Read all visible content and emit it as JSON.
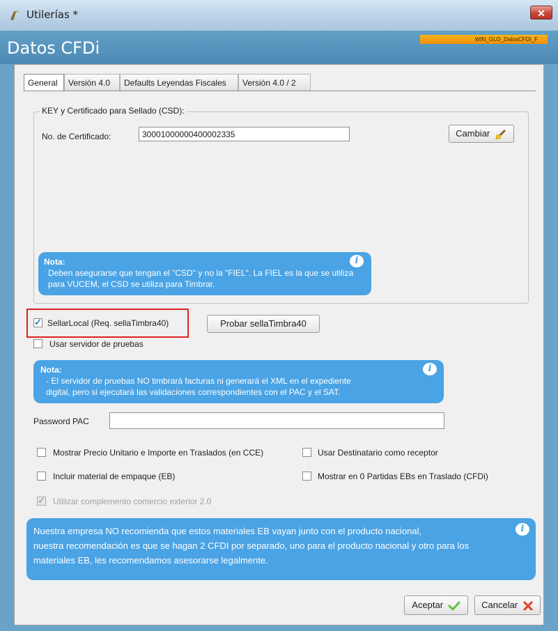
{
  "window": {
    "title": "Utilerías *",
    "close_label": "✕",
    "form_name": "WIN_GLO_DatosCFDI_F",
    "dialog_title": "Datos CFDi"
  },
  "tabs": [
    {
      "label": "General",
      "active": true
    },
    {
      "label": "Versión 4.0",
      "active": false
    },
    {
      "label": "Defaults Leyendas Fiscales",
      "active": false
    },
    {
      "label": "Versión 4.0 / 2",
      "active": false
    }
  ],
  "csd": {
    "legend": "KEY y Certificado para Sellado (CSD):",
    "cert_label": "No. de Certificado:",
    "cert_value": "30001000000400002335",
    "change_button": "Cambiar",
    "note_title": "Nota:",
    "note_text": "Deben asegurarse que tengan el \"CSD\" y no la \"FIEL\". La FIEL es la que se utiliza para VUCEM, el CSD se utiliza para Timbrar."
  },
  "sellar": {
    "checkbox_label": "SellarLocal (Req. sellaTimbra40)",
    "checked": true,
    "test_button": "Probar sellaTimbra40"
  },
  "test_server": {
    "checkbox_label": "Usar servidor de pruebas",
    "checked": false,
    "note_title": "Nota:",
    "note_line1": "- El servidor de pruebas NO timbrará facturas ni generará el XML en el expediente",
    "note_line2": "digital, pero si ejecutará las validaciones correspondientes con el PAC y el SAT."
  },
  "password": {
    "label": "Password PAC",
    "value": ""
  },
  "options": {
    "mostrar_precio": "Mostrar Precio Unitario e Importe en Traslados (en CCE)",
    "usar_destinatario": "Usar Destinatario como receptor",
    "incluir_material": "Incluir material de empaque (EB)",
    "mostrar_cero": "Mostrar en 0 Partidas EBs en Traslado (CFDi)",
    "comercio_exterior": "Utilizar complemento comercio exterior 2.0"
  },
  "eb_note": {
    "line1": "Nuestra empresa NO recomienda que estos materiales EB vayan junto con el producto nacional,",
    "line2": "nuestra recomendación es que se hagan 2 CFDI por separado, uno para el producto nacional y otro para los",
    "line3": "materiales EB, les recomendamos asesorarse legalmente."
  },
  "footer": {
    "accept": "Aceptar",
    "cancel": "Cancelar"
  },
  "colors": {
    "note_blue": "#4aa3e4",
    "header_blue": "#62a0c8",
    "highlight_red": "#e02020"
  }
}
